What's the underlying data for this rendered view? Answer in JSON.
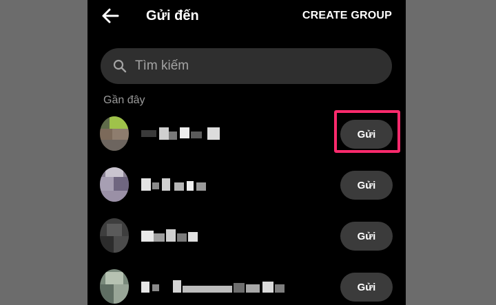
{
  "header": {
    "title": "Gửi đến",
    "create_group_label": "CREATE GROUP",
    "back_icon": "arrow-left-icon"
  },
  "search": {
    "placeholder": "Tìm kiếm",
    "value": "",
    "icon": "search-icon"
  },
  "recent": {
    "section_label": "Gần đây",
    "contacts": [
      {
        "send_label": "Gửi",
        "highlighted": true
      },
      {
        "send_label": "Gửi",
        "highlighted": false
      },
      {
        "send_label": "Gửi",
        "highlighted": false
      },
      {
        "send_label": "Gửi",
        "highlighted": false
      }
    ]
  },
  "colors": {
    "background": "#000000",
    "button": "#3b3b3b",
    "search_field": "#2f2f2f",
    "highlight": "#ff2a6d",
    "outer_frame": "#6c6c6c"
  }
}
